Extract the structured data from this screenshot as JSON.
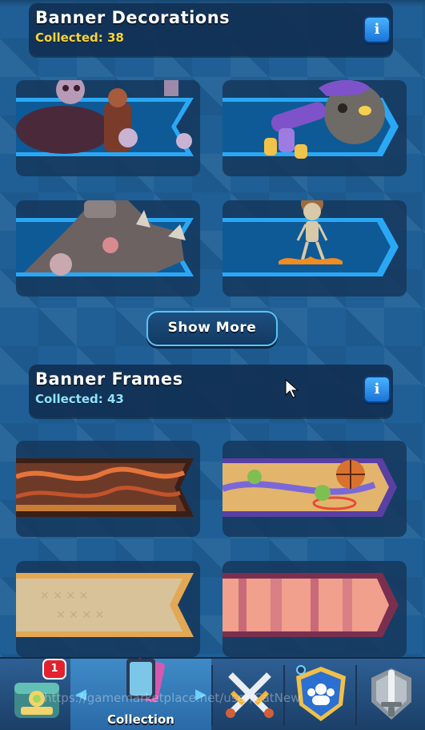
{
  "sections": {
    "decorations": {
      "title": "Banner Decorations",
      "collected": "Collected: 38",
      "collected_color": "#f7d53a"
    },
    "frames": {
      "title": "Banner Frames",
      "collected": "Collected: 43",
      "collected_color": "#8fe4ff"
    }
  },
  "info_label": "i",
  "show_more_label": "Show More",
  "decoration_items": [
    {
      "name": "skeleton-army-decoration"
    },
    {
      "name": "golem-fist-decoration"
    },
    {
      "name": "pekka-decoration"
    },
    {
      "name": "fire-skeleton-decoration"
    }
  ],
  "frame_items": [
    {
      "name": "lava-wood-frame"
    },
    {
      "name": "basketball-frame"
    },
    {
      "name": "sand-frame"
    },
    {
      "name": "pink-forest-frame"
    }
  ],
  "nav": {
    "badge_count": "1",
    "collection_label": "Collection",
    "tabs": [
      "chest-icon",
      "collection-icon",
      "battle-icon",
      "clan-icon",
      "tournament-icon"
    ]
  },
  "watermark": "https://gamemarketplace.net/user/CatNew"
}
